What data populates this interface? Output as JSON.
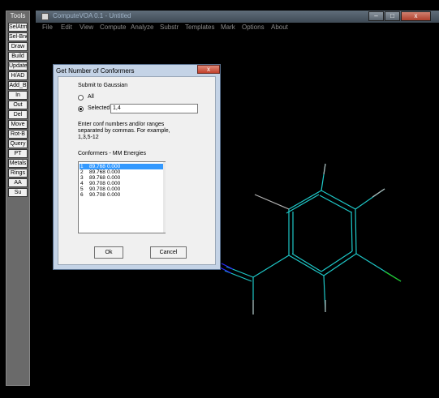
{
  "tools": {
    "title": "Tools",
    "buttons": [
      "SelAtm",
      "Sel-Bnd",
      "Draw",
      "Build",
      "Update",
      "H/AD",
      "Add_B",
      "In",
      "Out",
      "Del",
      "Move",
      "Rot-B",
      "Query",
      "PT",
      "Metals",
      "Rings",
      "AA",
      "Su"
    ]
  },
  "window": {
    "title": "ComputeVOA 0.1 - Untitled",
    "minimize_label": "–",
    "maximize_label": "□",
    "close_label": "x",
    "menu": [
      "File",
      "Edit",
      "View",
      "Compute",
      "Analyze",
      "Substr",
      "Templates",
      "Mark",
      "Options",
      "About"
    ]
  },
  "dialog": {
    "title": "Get Number of Conformers",
    "close_label": "x",
    "submit_label": "Submit to Gaussian",
    "all_label": "All",
    "selected_label": "Selected",
    "selected_value": "1,4",
    "help_line1": "Enter conf numbers and/or ranges",
    "help_line2": "separated by commas. For example,",
    "help_line3": "1,3,5-12",
    "list_header": "Conformers  - MM Energies",
    "conformers": [
      {
        "n": "1",
        "e1": "89.768",
        "e2": "0.000"
      },
      {
        "n": "2",
        "e1": "89.768",
        "e2": "0.000"
      },
      {
        "n": "3",
        "e1": "89.768",
        "e2": "0.000"
      },
      {
        "n": "4",
        "e1": "90.708",
        "e2": "0.000"
      },
      {
        "n": "5",
        "e1": "90.708",
        "e2": "0.000"
      },
      {
        "n": "6",
        "e1": "90.708",
        "e2": "0.000"
      }
    ],
    "ok_label": "Ok",
    "cancel_label": "Cancel"
  },
  "colors": {
    "bond": "#1ec8c8",
    "hydrogen": "#b4b4b4",
    "nitrogen": "#2a2aff",
    "chlorine": "#22cc22",
    "selection": "#3399ff"
  }
}
